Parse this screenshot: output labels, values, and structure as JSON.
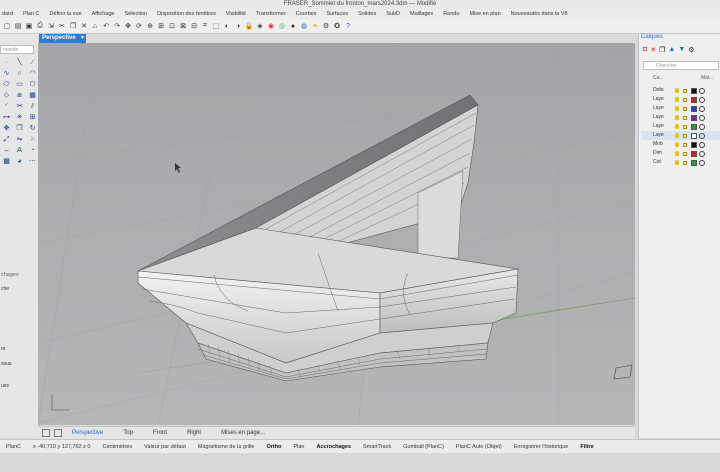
{
  "window": {
    "title": "FRASER_Sommier du fronton_mars2024.3dm — Modifié"
  },
  "menu": [
    "dard",
    "Plan C",
    "Définir la vue",
    "Affichage",
    "Sélection",
    "Disposition des fenêtres",
    "Visibilité",
    "Transformer",
    "Courbes",
    "Surfaces",
    "Solides",
    "SubD",
    "Maillages",
    "Rendu",
    "Mise en plan",
    "Nouveautés dans la V8"
  ],
  "left": {
    "search_placeholder": "mande",
    "panel_title": "chages",
    "panel_items": [
      "",
      "che",
      "",
      "",
      "",
      "",
      "",
      "",
      "",
      "re",
      "",
      "sous",
      "",
      "",
      "ues"
    ]
  },
  "viewport": {
    "active_label": "Perspective",
    "tabs": [
      "Perspective",
      "Top",
      "Front",
      "Right",
      "Mises en page..."
    ]
  },
  "status": {
    "plane": "PlanC",
    "coords": "x -40,710   y 127,762   z 0",
    "items": [
      "Centimètres",
      "Valeur par défaut",
      "Magnétisme de la grille",
      "Ortho",
      "Plan",
      "Accrochages",
      "SmartTrack",
      "Gumball (PlanC)",
      "PlanC Auto (Objet)",
      "Enregistrer l'historique",
      "Filtre"
    ],
    "items_on": [
      "Ortho",
      "Accrochages",
      "Filtre"
    ]
  },
  "layers": {
    "title": "Calques",
    "search_placeholder": "Chercher",
    "col_name": "Ca...",
    "col_mat": "Mat...",
    "rows": [
      {
        "name": "Defa",
        "color": "#111111",
        "selected": false
      },
      {
        "name": "Laye",
        "color": "#d62020",
        "selected": false
      },
      {
        "name": "Laye",
        "color": "#2040d0",
        "selected": false
      },
      {
        "name": "Laye",
        "color": "#7a20c0",
        "selected": false
      },
      {
        "name": "Laye",
        "color": "#20a040",
        "selected": false
      },
      {
        "name": "Laye",
        "color": "#ffffff",
        "selected": true
      },
      {
        "name": "Mob",
        "color": "#111111",
        "selected": false
      },
      {
        "name": "Dim",
        "color": "#d62020",
        "selected": false
      },
      {
        "name": "Cot",
        "color": "#20a040",
        "selected": false
      }
    ]
  }
}
